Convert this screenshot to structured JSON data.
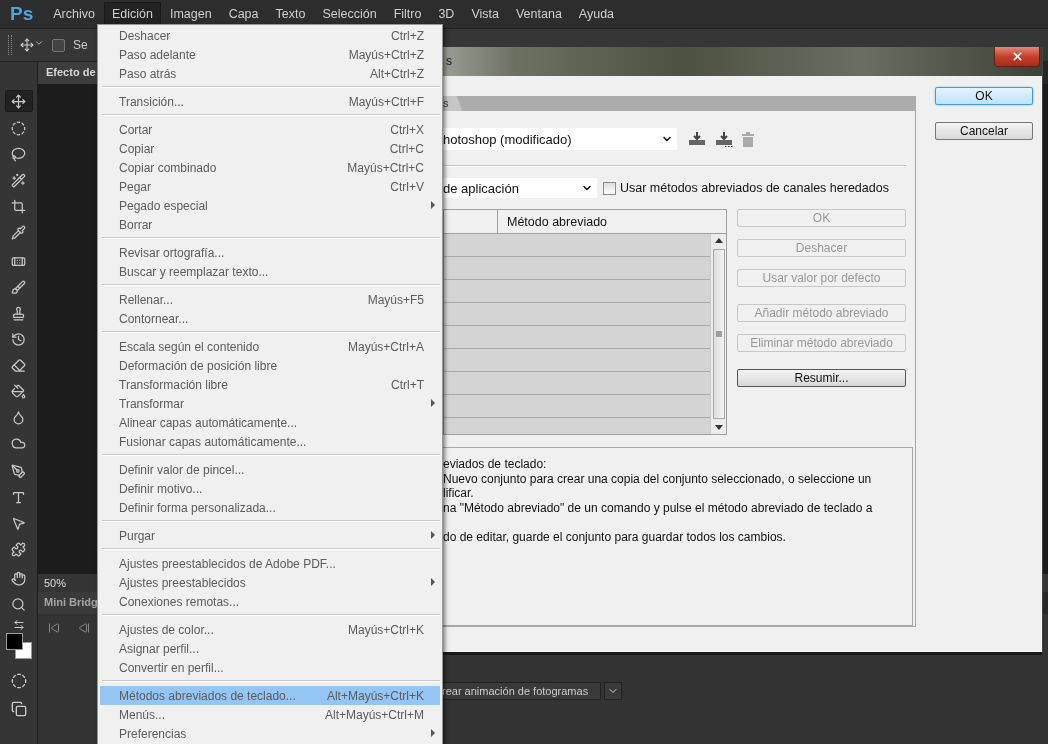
{
  "menu_bar": {
    "logo": "Ps",
    "items": [
      {
        "label": "Archivo",
        "selected": false
      },
      {
        "label": "Edición",
        "selected": true
      },
      {
        "label": "Imagen",
        "selected": false
      },
      {
        "label": "Capa",
        "selected": false
      },
      {
        "label": "Texto",
        "selected": false
      },
      {
        "label": "Selección",
        "selected": false
      },
      {
        "label": "Filtro",
        "selected": false
      },
      {
        "label": "3D",
        "selected": false
      },
      {
        "label": "Vista",
        "selected": false
      },
      {
        "label": "Ventana",
        "selected": false
      },
      {
        "label": "Ayuda",
        "selected": false
      }
    ]
  },
  "options_bar": {
    "checkbox": {
      "label": "Se",
      "checked": false
    }
  },
  "toolbox": {
    "tools": [
      {
        "selected": true
      },
      {
        "selected": false
      },
      {
        "selected": false
      },
      {
        "selected": false
      },
      {
        "selected": false
      },
      {
        "selected": false
      },
      {
        "selected": false
      },
      {
        "selected": false
      },
      {
        "selected": false
      },
      {
        "selected": false
      },
      {
        "selected": false
      },
      {
        "selected": false
      },
      {
        "selected": false
      },
      {
        "selected": false
      },
      {
        "selected": false
      },
      {
        "selected": false
      },
      {
        "selected": false
      },
      {
        "selected": false
      },
      {
        "selected": false
      },
      {
        "selected": false
      }
    ]
  },
  "document_tabs": [
    {
      "label": "Efecto de",
      "selected": true
    }
  ],
  "status_bar": {
    "zoom": "50%"
  },
  "bottom_panel": {
    "tab": "Mini Bridg",
    "timeline_button": "rear animación de fotogramas"
  },
  "edit_menu": {
    "groups": [
      [
        {
          "label": "Deshacer",
          "shortcut": "Ctrl+Z",
          "submenu": false,
          "selected": false
        },
        {
          "label": "Paso adelante",
          "shortcut": "Mayús+Ctrl+Z",
          "submenu": false,
          "selected": false
        },
        {
          "label": "Paso atrás",
          "shortcut": "Alt+Ctrl+Z",
          "submenu": false,
          "selected": false
        }
      ],
      [
        {
          "label": "Transición...",
          "shortcut": "Mayús+Ctrl+F",
          "submenu": false,
          "selected": false
        }
      ],
      [
        {
          "label": "Cortar",
          "shortcut": "Ctrl+X",
          "submenu": false,
          "selected": false
        },
        {
          "label": "Copiar",
          "shortcut": "Ctrl+C",
          "submenu": false,
          "selected": false
        },
        {
          "label": "Copiar combinado",
          "shortcut": "Mayús+Ctrl+C",
          "submenu": false,
          "selected": false
        },
        {
          "label": "Pegar",
          "shortcut": "Ctrl+V",
          "submenu": false,
          "selected": false
        },
        {
          "label": "Pegado especial",
          "submenu": true,
          "selected": false
        },
        {
          "label": "Borrar",
          "submenu": false,
          "selected": false
        }
      ],
      [
        {
          "label": "Revisar ortografía...",
          "submenu": false,
          "selected": false
        },
        {
          "label": "Buscar y reemplazar texto...",
          "submenu": false,
          "selected": false
        }
      ],
      [
        {
          "label": "Rellenar...",
          "shortcut": "Mayús+F5",
          "submenu": false,
          "selected": false
        },
        {
          "label": "Contornear...",
          "submenu": false,
          "selected": false
        }
      ],
      [
        {
          "label": "Escala según el contenido",
          "shortcut": "Mayús+Ctrl+A",
          "submenu": false,
          "selected": false
        },
        {
          "label": "Deformación de posición libre",
          "submenu": false,
          "selected": false
        },
        {
          "label": "Transformación libre",
          "shortcut": "Ctrl+T",
          "submenu": false,
          "selected": false
        },
        {
          "label": "Transformar",
          "submenu": true,
          "selected": false
        },
        {
          "label": "Alinear capas automáticamente...",
          "submenu": false,
          "selected": false
        },
        {
          "label": "Fusionar capas automáticamente...",
          "submenu": false,
          "selected": false
        }
      ],
      [
        {
          "label": "Definir valor de pincel...",
          "submenu": false,
          "selected": false
        },
        {
          "label": "Definir motivo...",
          "submenu": false,
          "selected": false
        },
        {
          "label": "Definir forma personalizada...",
          "submenu": false,
          "selected": false
        }
      ],
      [
        {
          "label": "Purgar",
          "submenu": true,
          "selected": false
        }
      ],
      [
        {
          "label": "Ajustes preestablecidos de Adobe PDF...",
          "submenu": false,
          "selected": false
        },
        {
          "label": "Ajustes preestablecidos",
          "submenu": true,
          "selected": false
        },
        {
          "label": "Conexiones remotas...",
          "submenu": false,
          "selected": false
        }
      ],
      [
        {
          "label": "Ajustes de color...",
          "shortcut": "Mayús+Ctrl+K",
          "submenu": false,
          "selected": false
        },
        {
          "label": "Asignar perfil...",
          "submenu": false,
          "selected": false
        },
        {
          "label": "Convertir en perfil...",
          "submenu": false,
          "selected": false
        }
      ],
      [
        {
          "label": "Métodos abreviados de teclado...",
          "shortcut": "Alt+Mayús+Ctrl+K",
          "submenu": false,
          "selected": true
        },
        {
          "label": "Menús...",
          "shortcut": "Alt+Mayús+Ctrl+M",
          "submenu": false,
          "selected": false
        },
        {
          "label": "Preferencias",
          "submenu": true,
          "selected": false
        }
      ]
    ]
  },
  "dialog": {
    "title": "s",
    "tab": "s",
    "set": "hotoshop (modificado)",
    "context": "de aplicación",
    "legacy_checkbox": {
      "label": "Usar métodos abreviados de canales heredados",
      "checked": false
    },
    "table": {
      "columns": [
        "Método abreviado"
      ]
    },
    "button_groups": [
      [
        {
          "label": "OK",
          "disabled": true
        },
        {
          "label": "Deshacer",
          "disabled": true
        },
        {
          "label": "Usar valor por defecto",
          "disabled": true
        }
      ],
      [
        {
          "label": "Añadir método abreviado",
          "disabled": true
        },
        {
          "label": "Eliminar método abreviado",
          "disabled": true
        }
      ],
      [
        {
          "label": "Resumir...",
          "disabled": false
        }
      ]
    ],
    "description": [
      [
        "eviados de teclado:",
        "Nuevo conjunto para crear una copia del conjunto seleccionado, o seleccione un",
        "lificar.",
        "na \"Método abreviado\" de un comando y pulse el método abreviado de teclado a"
      ],
      [
        "do de editar, guarde el conjunto para guardar todos los cambios."
      ]
    ],
    "actions": [
      {
        "label": "OK",
        "default": true
      },
      {
        "label": "Cancelar",
        "default": false
      }
    ]
  }
}
